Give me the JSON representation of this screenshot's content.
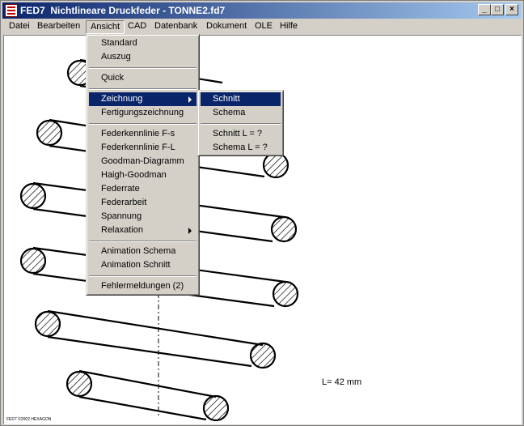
{
  "title": {
    "app": "FED7",
    "text": "Nichtlineare Druckfeder  -  TONNE2.fd7"
  },
  "title_buttons": {
    "minimize": "_",
    "maximize": "□",
    "close": "×"
  },
  "menubar": [
    {
      "label": "Datei"
    },
    {
      "label": "Bearbeiten"
    },
    {
      "label": "Ansicht"
    },
    {
      "label": "CAD"
    },
    {
      "label": "Datenbank"
    },
    {
      "label": "Dokument"
    },
    {
      "label": "OLE"
    },
    {
      "label": "Hilfe"
    }
  ],
  "ansicht_menu": {
    "items": [
      "Standard",
      "Auszug",
      "Quick",
      "Zeichnung",
      "Fertigungszeichnung",
      "Federkennlinie F-s",
      "Federkennlinie F-L",
      "Goodman-Diagramm",
      "Haigh-Goodman",
      "Federrate",
      "Federarbeit",
      "Spannung",
      "Relaxation",
      "Animation Schema",
      "Animation Schnitt",
      "Fehlermeldungen (2)"
    ]
  },
  "zeichnung_submenu": {
    "items": [
      "Schnitt",
      "Schema",
      "Schnitt L = ?",
      "Schema L = ?"
    ]
  },
  "drawing": {
    "length_label": "L= 42 mm",
    "footer_text": "FED7 ©2002 HEXAGON"
  },
  "colors": {
    "title_active": "#0a246a",
    "menu_highlight": "#0a246a",
    "face": "#d4d0c8"
  }
}
